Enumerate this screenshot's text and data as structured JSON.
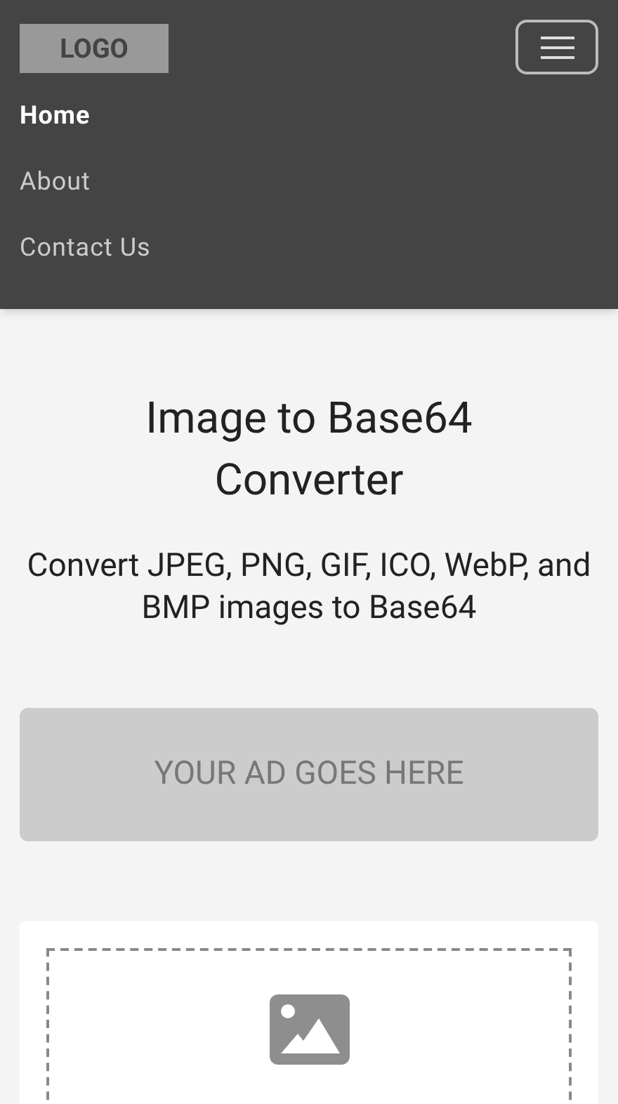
{
  "header": {
    "logo": "LOGO",
    "nav": [
      {
        "label": "Home",
        "selected": true
      },
      {
        "label": "About",
        "selected": false
      },
      {
        "label": "Contact Us",
        "selected": false
      }
    ]
  },
  "title": "Image to Base64 Converter",
  "subtitle": "Convert JPEG, PNG, GIF, ICO, WebP, and BMP images to Base64",
  "ad": "YOUR AD GOES HERE"
}
